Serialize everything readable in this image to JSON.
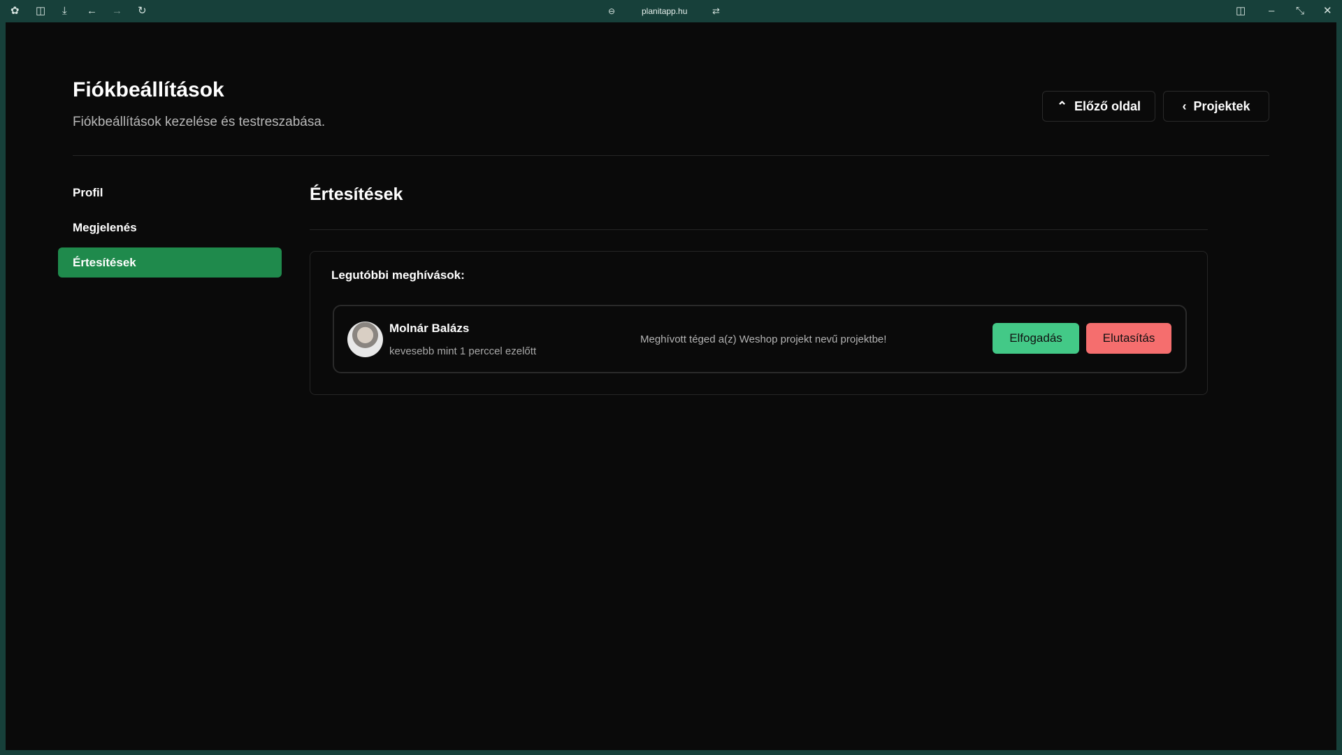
{
  "browser": {
    "url": "planitapp.hu"
  },
  "header": {
    "title": "Fiókbeállítások",
    "subtitle": "Fiókbeállítások kezelése és testreszabása.",
    "prev_label": "Előző oldal",
    "projects_label": "Projektek"
  },
  "sidebar": {
    "items": [
      {
        "label": "Profil"
      },
      {
        "label": "Megjelenés"
      },
      {
        "label": "Értesítések"
      }
    ]
  },
  "main": {
    "heading": "Értesítések",
    "section_label": "Legutóbbi meghívások:",
    "invite": {
      "name": "Molnár Balázs",
      "time": "kevesebb mint 1 perccel ezelőtt",
      "message": "Meghívott téged a(z) Weshop projekt nevű projektbe!",
      "accept_label": "Elfogadás",
      "reject_label": "Elutasítás"
    }
  },
  "colors": {
    "accept": "#43c987",
    "reject": "#f56e6e",
    "active": "#1f8a4c"
  }
}
